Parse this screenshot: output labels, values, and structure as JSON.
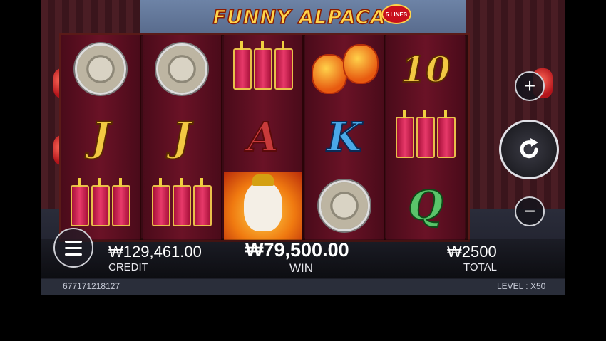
{
  "game": {
    "logo_text": "FUNNY ALPACA",
    "lines_badge": "5 LINES"
  },
  "reels": [
    [
      "gong",
      "J",
      "firecrackers"
    ],
    [
      "gong",
      "J",
      "firecrackers"
    ],
    [
      "firecrackers",
      "A",
      "alpaca-wild"
    ],
    [
      "lanterns",
      "K",
      "gong"
    ],
    [
      "10",
      "firecrackers",
      "Q"
    ]
  ],
  "symbols": {
    "J": "J",
    "A": "A",
    "K": "K",
    "Q": "Q",
    "ten": "10"
  },
  "credit": {
    "value": "₩129,461.00",
    "label": "CREDIT"
  },
  "win": {
    "value": "₩79,500.00",
    "label": "WIN"
  },
  "total": {
    "value": "₩2500",
    "label": "TOTAL"
  },
  "info": {
    "session_id": "677171218127",
    "level_label": "LEVEL : ",
    "level_value": "X50"
  },
  "buttons": {
    "plus_icon": "plus-icon",
    "minus_icon": "minus-icon",
    "spin_icon": "refresh-arrow-icon",
    "menu_icon": "hamburger-icon"
  },
  "colors": {
    "gold": "#f2c842",
    "reel_bg": "#6a1226",
    "win_text": "#ffffff"
  }
}
